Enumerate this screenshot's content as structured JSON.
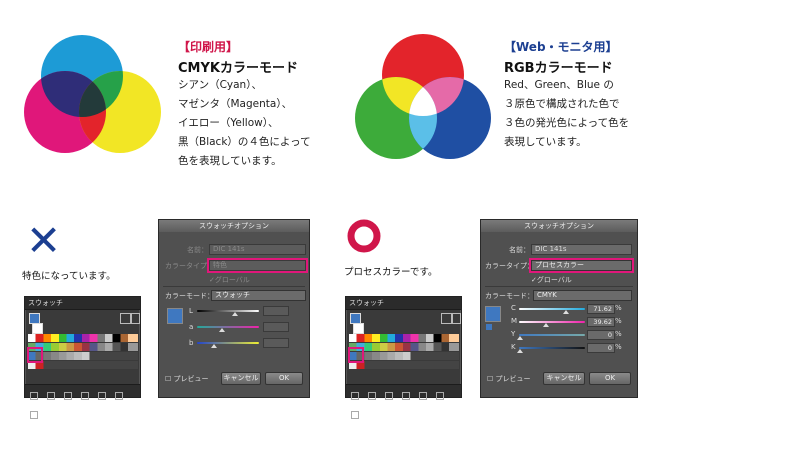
{
  "cmyk": {
    "tag": "【印刷用】",
    "title": "CMYKカラーモード",
    "lines": [
      "シアン（Cyan）、",
      "マゼンタ（Magenta）、",
      "イエロー（Yellow）、",
      "黒（Black）の４色によって",
      "色を表現しています。"
    ]
  },
  "rgb": {
    "tag": "【Web・モニタ用】",
    "title": "RGBカラーモード",
    "lines": [
      "Red、Green、Blue の",
      "３原色で構成された色で",
      "３色の発光色によって色を",
      "表現しています。"
    ]
  },
  "left_example": {
    "mark": "✕",
    "caption": "特色になっています。",
    "panel_title": "スウォッチ",
    "dialog": {
      "title": "スウォッチオプション",
      "name_label": "名前：",
      "name_value": "DIC 141s",
      "color_type_label": "カラータイプ：",
      "color_type_value": "特色",
      "global_label": "グローバル",
      "color_mode_label": "カラーモード：",
      "color_mode_value": "スウォッチ",
      "channels": [
        "L",
        "a",
        "b"
      ],
      "preview_label": "プレビュー",
      "cancel_label": "キャンセル",
      "ok_label": "OK"
    }
  },
  "right_example": {
    "caption": "プロセスカラーです。",
    "panel_title": "スウォッチ",
    "dialog": {
      "title": "スウォッチオプション",
      "name_label": "名前：",
      "name_value": "DIC 141s",
      "color_type_label": "カラータイプ：",
      "color_type_value": "プロセスカラー",
      "global_label": "グローバル",
      "color_mode_label": "カラーモード：",
      "color_mode_value": "CMYK",
      "channels": [
        {
          "label": "C",
          "value": "71.62",
          "unit": "%"
        },
        {
          "label": "M",
          "value": "39.62",
          "unit": "%"
        },
        {
          "label": "Y",
          "value": "0",
          "unit": "%"
        },
        {
          "label": "K",
          "value": "0",
          "unit": "%"
        }
      ],
      "preview_label": "プレビュー",
      "cancel_label": "キャンセル",
      "ok_label": "OK"
    }
  },
  "colors": {
    "cyan": "#1d9bd6",
    "magenta": "#e0177a",
    "yellow": "#f2e625",
    "red": "#e3242b",
    "green": "#3dab3a",
    "blue": "#1f4fa3",
    "swatch_blue": "#3f78c0",
    "highlight": "#e0177a",
    "x_mark": "#1c3f91",
    "o_mark": "#d0164a"
  }
}
